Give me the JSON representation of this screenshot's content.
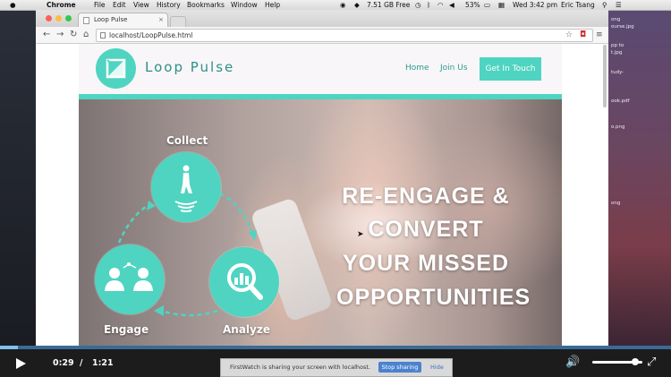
{
  "menubar": {
    "app": "Chrome",
    "items": [
      "File",
      "Edit",
      "View",
      "History",
      "Bookmarks",
      "Window",
      "Help"
    ],
    "disk": "7.51 GB Free",
    "battery": "53%",
    "clock": "Wed 3:42 pm",
    "user": "Eric Tsang"
  },
  "desktop": {
    "files": [
      "ong",
      "ourse.jpg",
      "pp to",
      "t.jpg",
      "tudy-",
      "ook.pdf",
      "o.png",
      "ong"
    ]
  },
  "browser": {
    "tab_title": "Loop Pulse",
    "tab_close": "×",
    "url": "localhost/LoopPulse.html"
  },
  "site": {
    "brand": "Loop Pulse",
    "nav": [
      "Home",
      "Join Us"
    ],
    "cta": "Get In Touch",
    "cycle": [
      "Collect",
      "Analyze",
      "Engage"
    ],
    "hero_lines": [
      "RE-ENGAGE &",
      "CONVERT",
      "YOUR MISSED",
      "OPPORTUNITIES"
    ]
  },
  "player": {
    "current_time": "0:29",
    "separator": "/",
    "total_time": "1:21",
    "progress": 0.027,
    "volume": 0.85
  },
  "share_notice": {
    "text": "FirstWatch is sharing your screen with localhost.",
    "stop": "Stop sharing",
    "hide": "Hide"
  },
  "colors": {
    "accent": "#4fd4c1",
    "accent_dark": "#2a9b92"
  }
}
